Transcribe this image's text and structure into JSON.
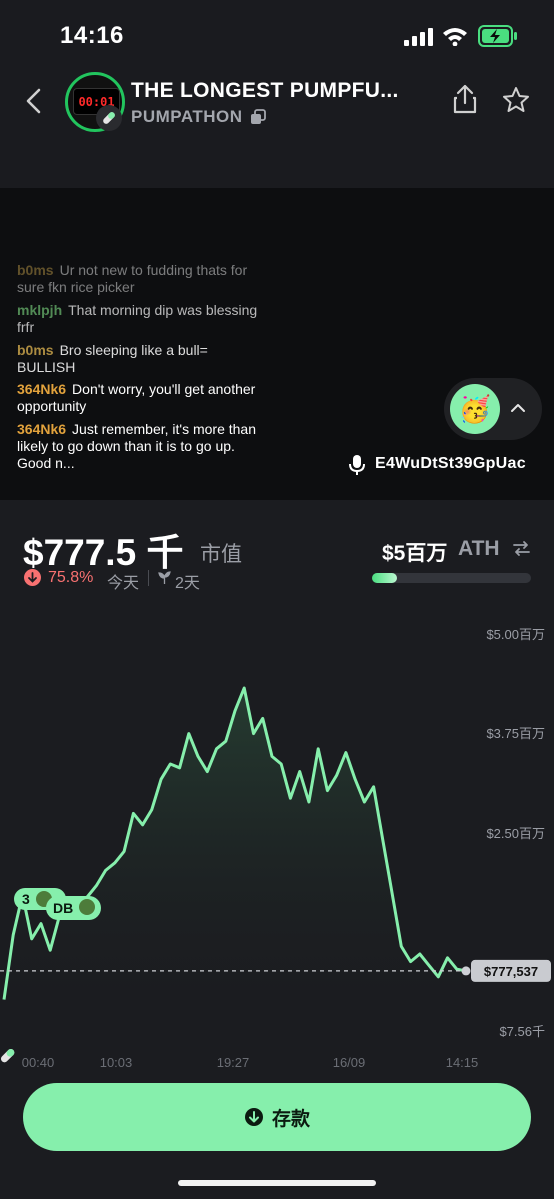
{
  "status": {
    "time": "14:16"
  },
  "header": {
    "title": "THE LONGEST PUMPFU...",
    "subtitle": "PUMPATHON",
    "timer": "00:01"
  },
  "chat": {
    "messages": [
      {
        "user": "b0ms",
        "text": "Ur not new to fudding thats for sure fkn rice picker",
        "color": "#c8a24a"
      },
      {
        "user": "mklpjh",
        "text": "That morning dip was blessing frfr",
        "color": "#6fbf73"
      },
      {
        "user": "b0ms",
        "text": "Bro sleeping like a bull= BULLISH",
        "color": "#c8a24a"
      },
      {
        "user": "364Nk6",
        "text": "Don't worry, you'll get another opportunity",
        "color": "#e2a23c"
      },
      {
        "user": "364Nk6",
        "text": "Just remember, it's more than likely to go down than it is to go up. Good n...",
        "color": "#e2a23c"
      }
    ]
  },
  "stream": {
    "speaker": "E4WuDtSt39GpUac",
    "emoji": "🥳"
  },
  "market": {
    "cap": "$777.5 千",
    "cap_label": "市值",
    "change": "75.8%",
    "change_period": "今天",
    "age": "2天",
    "ath_value": "$5百万",
    "ath_label": "ATH",
    "ath_progress": 0.155
  },
  "chart_data": {
    "type": "line",
    "x_ticks": [
      "00:40",
      "10:03",
      "19:27",
      "16/09",
      "14:15"
    ],
    "y_ticks": [
      "$5.00百万",
      "$3.75百万",
      "$2.50百万",
      "$7.56千"
    ],
    "ylim": [
      0,
      5000000
    ],
    "current_label": "$777,537",
    "current_value": 777537,
    "markers": [
      "3",
      "DB"
    ],
    "series": [
      {
        "values": [
          400000,
          1250000,
          1780000,
          1200000,
          1400000,
          1050000,
          1500000,
          1600000,
          1700000,
          1750000,
          1900000,
          2100000,
          2200000,
          2350000,
          2850000,
          2700000,
          2900000,
          3300000,
          3500000,
          3450000,
          3900000,
          3600000,
          3400000,
          3700000,
          3800000,
          4200000,
          4500000,
          3900000,
          4100000,
          3600000,
          3500000,
          3050000,
          3400000,
          3000000,
          3700000,
          3150000,
          3350000,
          3650000,
          3300000,
          3000000,
          3200000,
          2500000,
          1800000,
          1100000,
          900000,
          1000000,
          850000,
          700000,
          950000,
          800000,
          777537
        ]
      }
    ]
  },
  "actions": {
    "deposit": "存款"
  }
}
